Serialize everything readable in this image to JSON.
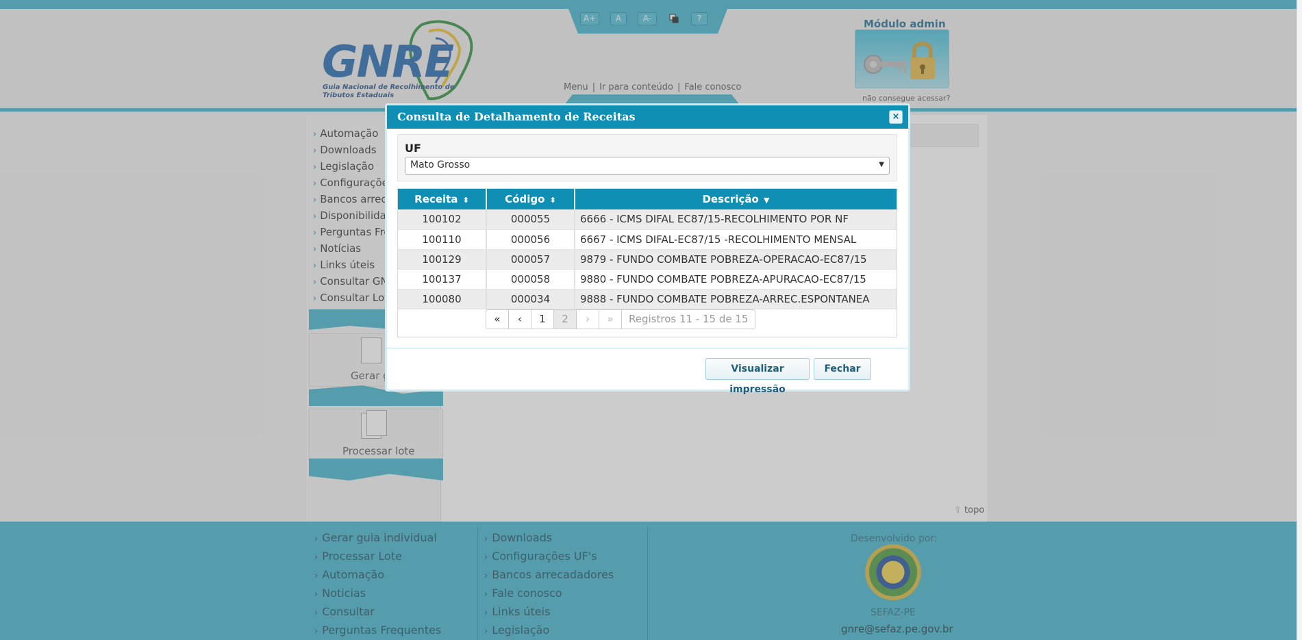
{
  "header": {
    "accessibility": [
      "A+",
      "A",
      "A-",
      "?"
    ],
    "logo_text": "GNRE",
    "logo_subtitle": "Guia Nacional de Recolhimento de Tributos Estaduais",
    "links": [
      "Menu",
      "Ir para conteúdo",
      "Fale conosco"
    ],
    "admin_title": "Módulo admin",
    "admin_link": "não consegue acessar?"
  },
  "sidebar": {
    "items": [
      "Automação",
      "Downloads",
      "Legislação",
      "Configuraçõe",
      "Bancos arreca",
      "Disponibilidad",
      "Perguntas Fre",
      "Notícias",
      "Links úteis",
      "Consultar GN",
      "Consultar Lot"
    ],
    "card1_label": "Gerar g",
    "card2_label": "Processar lote"
  },
  "topo_label": "topo",
  "footer": {
    "col1": [
      "Gerar guia individual",
      "Processar Lote",
      "Automação",
      "Noticias",
      "Consultar",
      "Perguntas Frequentes"
    ],
    "col2": [
      "Downloads",
      "Configurações UF's",
      "Bancos arrecadadores",
      "Fale conosco",
      "Links úteis",
      "Legislação"
    ],
    "dev_by": "Desenvolvido por:",
    "org": "SEFAZ-PE",
    "email": "gnre@sefaz.pe.gov.br"
  },
  "modal": {
    "title": "Consulta de Detalhamento de Receitas",
    "close": "×",
    "uf_label": "UF",
    "uf_value": "Mato Grosso",
    "columns": [
      "Receita",
      "Código",
      "Descrição"
    ],
    "rows": [
      [
        "100102",
        "000055",
        "6666 - ICMS DIFAL EC87/15-RECOLHIMENTO POR NF"
      ],
      [
        "100110",
        "000056",
        "6667 - ICMS DIFAL-EC87/15 -RECOLHIMENTO MENSAL"
      ],
      [
        "100129",
        "000057",
        "9879 - FUNDO COMBATE POBREZA-OPERACAO-EC87/15"
      ],
      [
        "100137",
        "000058",
        "9880 - FUNDO COMBATE POBREZA-APURACAO-EC87/15"
      ],
      [
        "100080",
        "000034",
        "9888 - FUNDO COMBATE POBREZA-ARREC.ESPONTANEA"
      ]
    ],
    "pager": {
      "first": "«",
      "prev": "‹",
      "page1": "1",
      "page2": "2",
      "next": "›",
      "last": "»",
      "info": "Registros 11 - 15 de 15"
    },
    "btn_print": "Visualizar impressão",
    "btn_close": "Fechar"
  },
  "colors": {
    "accent": "#3fb3cc",
    "modal_header": "#0f8fb3"
  }
}
